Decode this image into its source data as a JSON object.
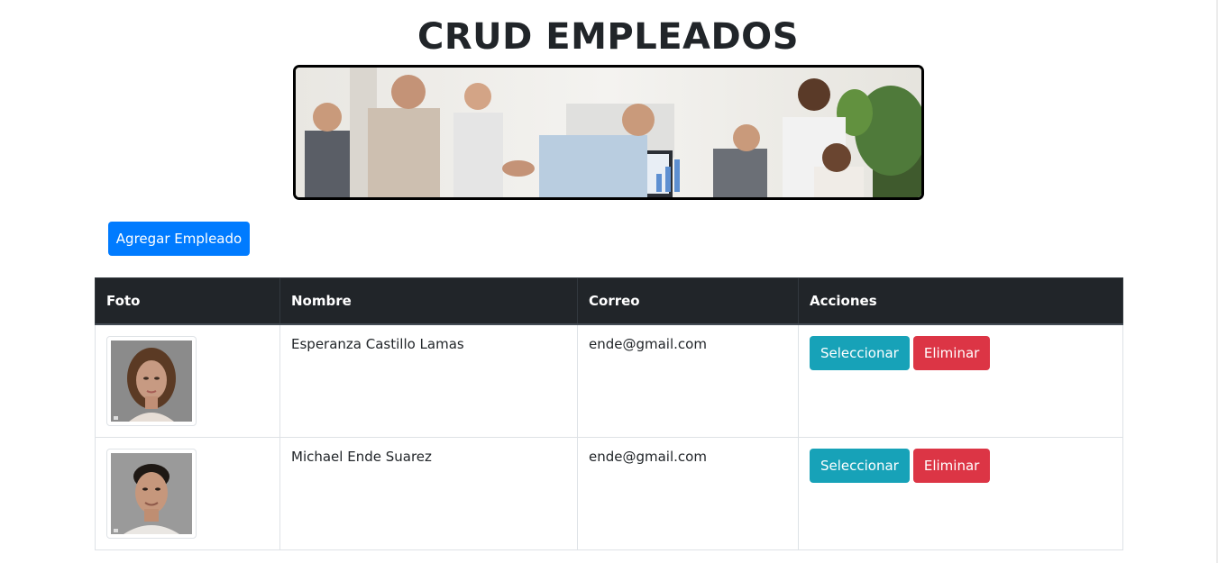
{
  "page": {
    "title": "CRUD EMPLEADOS"
  },
  "banner": {
    "icon": "team-photo"
  },
  "toolbar": {
    "add_label": "Agregar Empleado"
  },
  "table": {
    "headers": [
      "Foto",
      "Nombre",
      "Correo",
      "Acciones"
    ],
    "rows": [
      {
        "photo": "woman-portrait",
        "nombre": "Esperanza Castillo Lamas",
        "correo": "ende@gmail.com",
        "select_label": "Seleccionar",
        "delete_label": "Eliminar"
      },
      {
        "photo": "man-portrait",
        "nombre": "Michael Ende Suarez",
        "correo": "ende@gmail.com",
        "select_label": "Seleccionar",
        "delete_label": "Eliminar"
      }
    ]
  },
  "colors": {
    "primary": "#007bff",
    "info": "#17a2b8",
    "danger": "#dc3545",
    "table_header": "#212529"
  }
}
